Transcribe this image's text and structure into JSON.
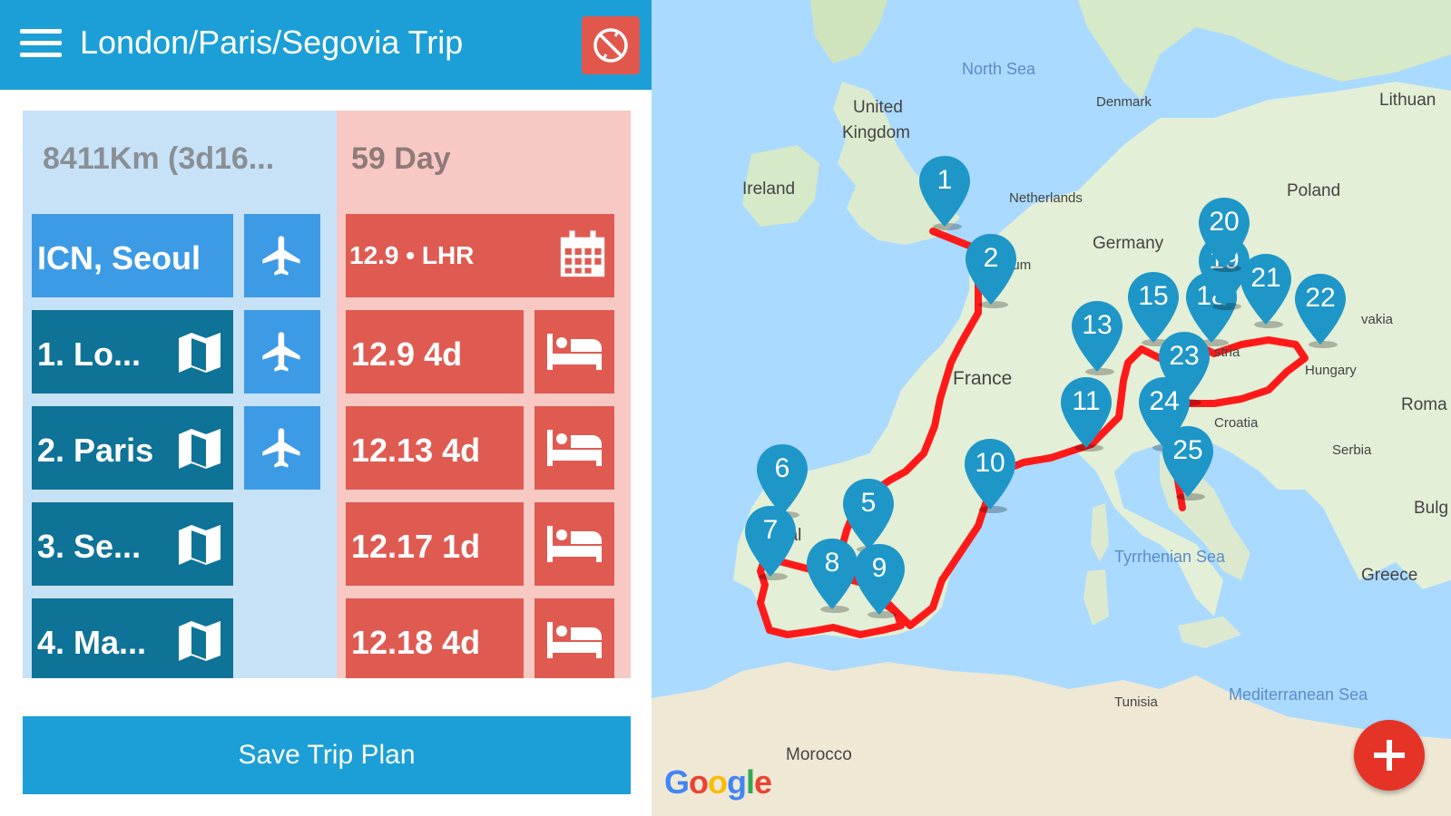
{
  "header": {
    "title": "London/Paris/Segovia Trip"
  },
  "summary": {
    "distance": "8411Km (3d16...",
    "duration": "59 Day"
  },
  "origin": {
    "label": "ICN, Seoul",
    "arrival": "12.9 • LHR"
  },
  "stops": [
    {
      "label": "1. Lo...",
      "stay": "12.9 4d",
      "has_flight": true
    },
    {
      "label": "2. Paris",
      "stay": "12.13 4d",
      "has_flight": true
    },
    {
      "label": "3. Se...",
      "stay": "12.17 1d",
      "has_flight": false
    },
    {
      "label": "4. Ma...",
      "stay": "12.18 4d",
      "has_flight": false
    }
  ],
  "save_button": {
    "label": "Save Trip Plan"
  },
  "map": {
    "labels": {
      "north_sea": "North Sea",
      "uk": "United",
      "uk2": "Kingdom",
      "denmark": "Denmark",
      "lithuania": "Lithuan",
      "ireland": "Ireland",
      "netherlands": "Netherlands",
      "poland": "Poland",
      "germany": "Germany",
      "belgium": "elgium",
      "slovakia": "vakia",
      "france": "France",
      "hungary": "Hungary",
      "austria": "stria",
      "romania": "Roma",
      "croatia": "Croatia",
      "serbia": "Serbia",
      "bulgaria": "Bulg",
      "portugal": "gal",
      "tyrrhenian": "Tyrrhenian Sea",
      "greece": "Greece",
      "tunisia": "Tunisia",
      "med_sea": "Mediterranean Sea",
      "morocco": "Morocco"
    },
    "markers": [
      "1",
      "2",
      "5",
      "6",
      "7",
      "8",
      "9",
      "10",
      "11",
      "13",
      "15",
      "18",
      "19",
      "20",
      "21",
      "22",
      "23",
      "24",
      "25"
    ],
    "route_color": "#ff1a1a",
    "marker_color": "#1e96c8",
    "logo": "Google"
  },
  "colors": {
    "primary": "#1c9fd6",
    "accent_red": "#df5b52",
    "dark_blue": "#0e7396",
    "light_blue": "#3d9be6"
  }
}
